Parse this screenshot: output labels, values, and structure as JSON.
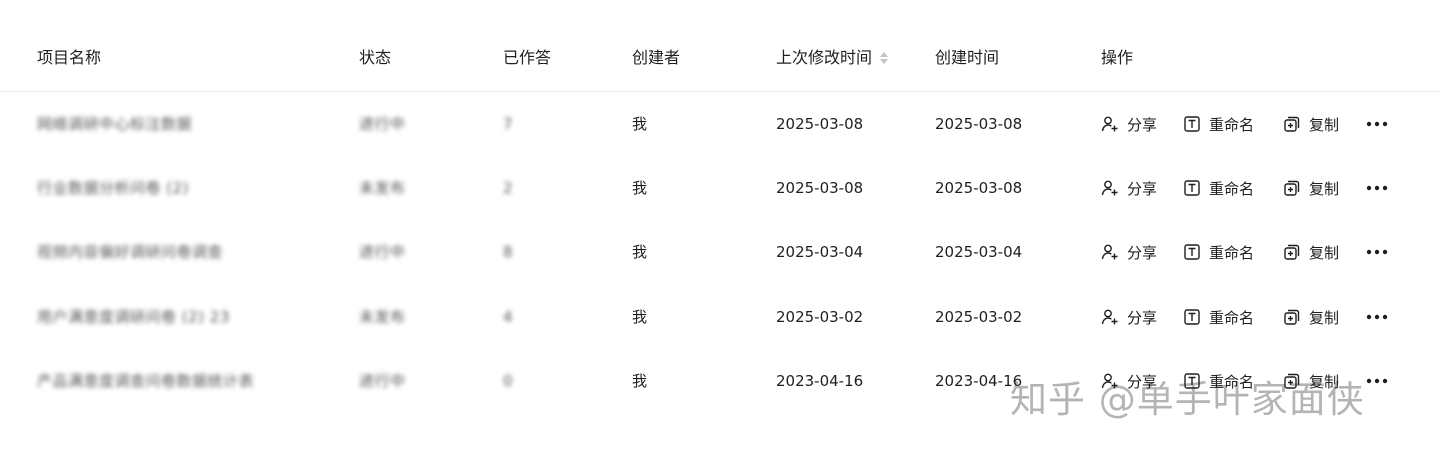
{
  "header": {
    "columns": [
      "项目名称",
      "状态",
      "已作答",
      "创建者",
      "上次修改时间",
      "创建时间",
      "操作"
    ]
  },
  "actions": {
    "share": "分享",
    "rename": "重命名",
    "copy": "复制",
    "more_icon": "more-horizontal-icon"
  },
  "rows": [
    {
      "name": "网络调研中心标注数据",
      "status": "进行中",
      "answered": "7",
      "creator": "我",
      "modified": "2025-03-08",
      "created": "2025-03-08"
    },
    {
      "name": "行业数据分析问卷 (2)",
      "status": "未发布",
      "answered": "2",
      "creator": "我",
      "modified": "2025-03-08",
      "created": "2025-03-08"
    },
    {
      "name": "视频内容偏好调研问卷调查",
      "status": "进行中",
      "answered": "8",
      "creator": "我",
      "modified": "2025-03-04",
      "created": "2025-03-04"
    },
    {
      "name": "用户满意度调研问卷 (2) 23",
      "status": "未发布",
      "answered": "4",
      "creator": "我",
      "modified": "2025-03-02",
      "created": "2025-03-02"
    },
    {
      "name": "产品满意度调查问卷数据统计表",
      "status": "进行中",
      "answered": "0",
      "creator": "我",
      "modified": "2023-04-16",
      "created": "2023-04-16"
    }
  ],
  "watermark": "知乎 @单手叶家面侠",
  "colors": {
    "border": "#ececec",
    "text": "#1f1f1f",
    "sort_icon": "#c4c4c4"
  }
}
